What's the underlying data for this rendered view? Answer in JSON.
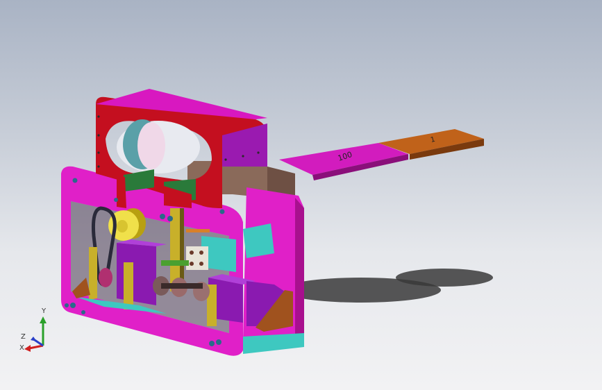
{
  "viewport": {
    "background_top": "#a9b3c4",
    "background_bottom": "#f2f2f4"
  },
  "model": {
    "label_plate_100": "100",
    "label_plate_1": "1",
    "colors": {
      "magenta": "#e020c8",
      "red": "#c40f1f",
      "violet": "#8a1ab0",
      "cyan": "#3ec8c0",
      "yellow": "#e8d23a",
      "brown": "#a0521e",
      "orange": "#c46a1a",
      "taupe": "#8a6a5a",
      "gray": "#9a9aa0"
    }
  },
  "triad": {
    "x_label": "X",
    "y_label": "Y",
    "z_label": "Z"
  }
}
